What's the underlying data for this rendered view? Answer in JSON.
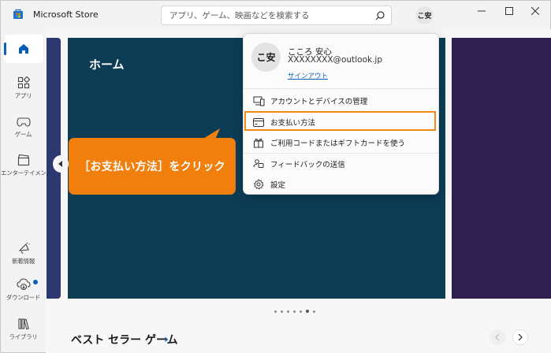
{
  "window": {
    "title": "Microsoft Store",
    "search_placeholder": "アプリ、ゲーム、映画などを検索する",
    "account_initials": "こ安"
  },
  "sidebar": {
    "items": [
      {
        "label": "",
        "icon": "home-icon",
        "active": true
      },
      {
        "label": "アプリ",
        "icon": "apps-icon"
      },
      {
        "label": "ゲーム",
        "icon": "gamepad-icon"
      },
      {
        "label": "エンターテイメント",
        "icon": "clapperboard-icon"
      },
      {
        "label": "新着情報",
        "icon": "megaphone-icon"
      },
      {
        "label": "ダウンロード",
        "icon": "download-cloud-icon"
      },
      {
        "label": "ライブラリ",
        "icon": "library-icon"
      }
    ]
  },
  "hero": {
    "title": "ホーム",
    "carousel_dots": 7,
    "active_dot": 5
  },
  "section": {
    "title": "ベスト セラー ゲーム",
    "chevron": "›"
  },
  "callout": {
    "text": "［お支払い方法］をクリック",
    "color": "#f07f0e"
  },
  "account_menu": {
    "initials": "こ安",
    "name": "こころ 安心",
    "email": "XXXXXXXX@outlook.jp",
    "signout": "サインアウト",
    "items": [
      {
        "label": "アカウントとデバイスの管理",
        "icon": "devices-icon"
      },
      {
        "label": "お支払い方法",
        "icon": "credit-card-icon",
        "highlighted": true
      },
      {
        "label": "ご利用コードまたはギフトカードを使う",
        "icon": "gift-icon"
      },
      {
        "label": "フィードバックの送信",
        "icon": "feedback-icon"
      },
      {
        "label": "設定",
        "icon": "gear-icon"
      }
    ]
  },
  "colors": {
    "accent": "#0a5fb4",
    "hero_bg": "#0c3d55",
    "highlight_border": "#f08a1a"
  }
}
